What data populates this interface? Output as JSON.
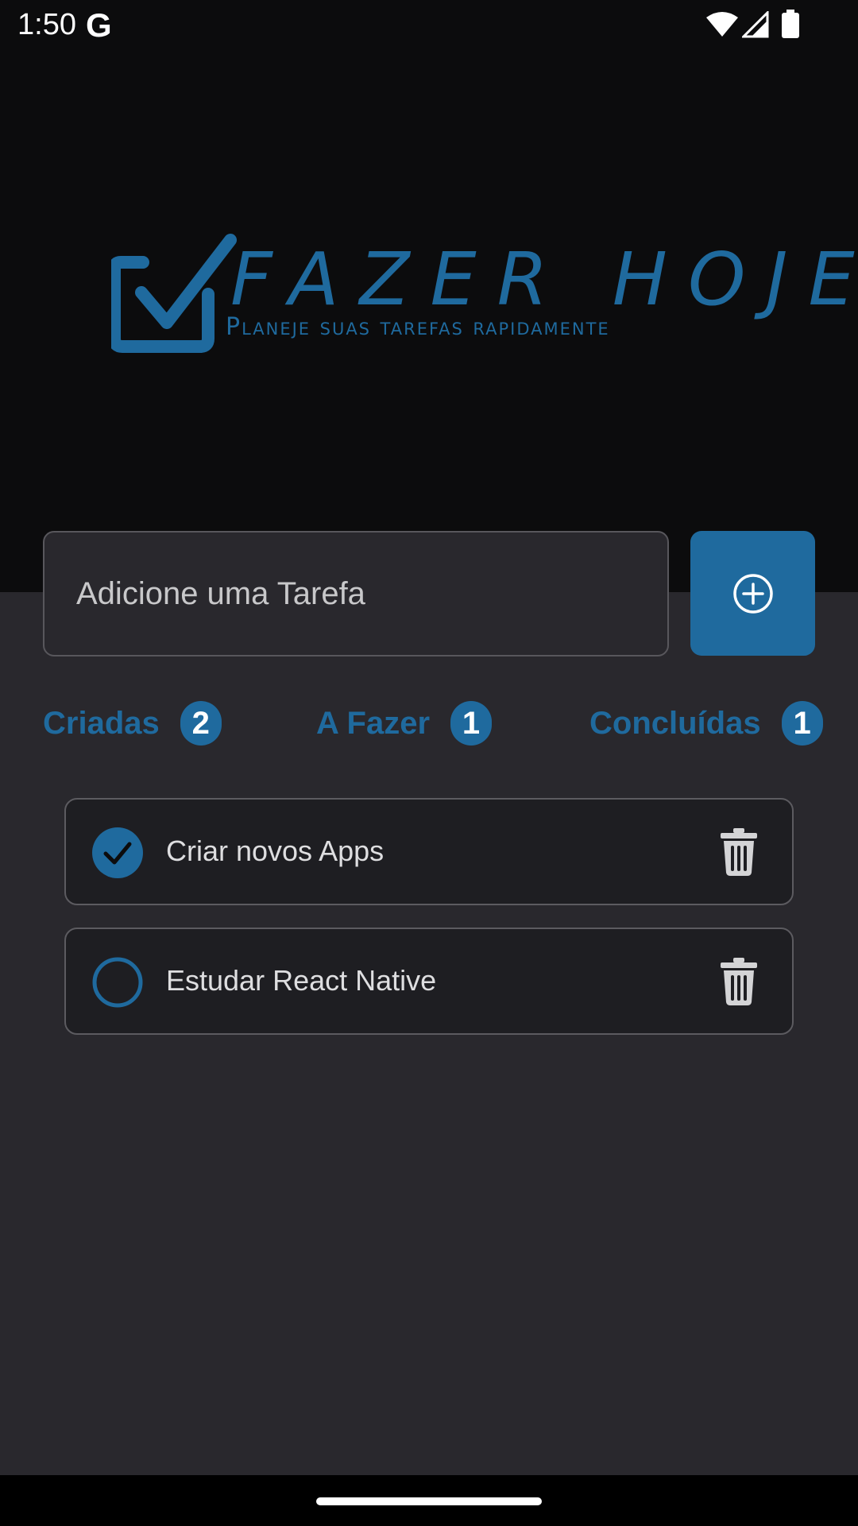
{
  "status_bar": {
    "time": "1:50",
    "google_icon": "G"
  },
  "logo": {
    "title": "FAZER HOJE",
    "subtitle": "Planeje suas tarefas rapidamente",
    "icon": "check-box-icon"
  },
  "input": {
    "placeholder": "Adicione uma Tarefa",
    "value": ""
  },
  "add_button": {
    "icon": "plus-circle-icon"
  },
  "counters": [
    {
      "label": "Criadas",
      "count": "2"
    },
    {
      "label": "A Fazer",
      "count": "1"
    },
    {
      "label": "Concluídas",
      "count": "1"
    }
  ],
  "tasks": [
    {
      "text": "Criar novos Apps",
      "done": true
    },
    {
      "text": "Estudar React Native",
      "done": false
    }
  ],
  "colors": {
    "accent": "#1f6a9e",
    "top_bg": "#0c0c0d",
    "body_bg": "#29282d"
  }
}
